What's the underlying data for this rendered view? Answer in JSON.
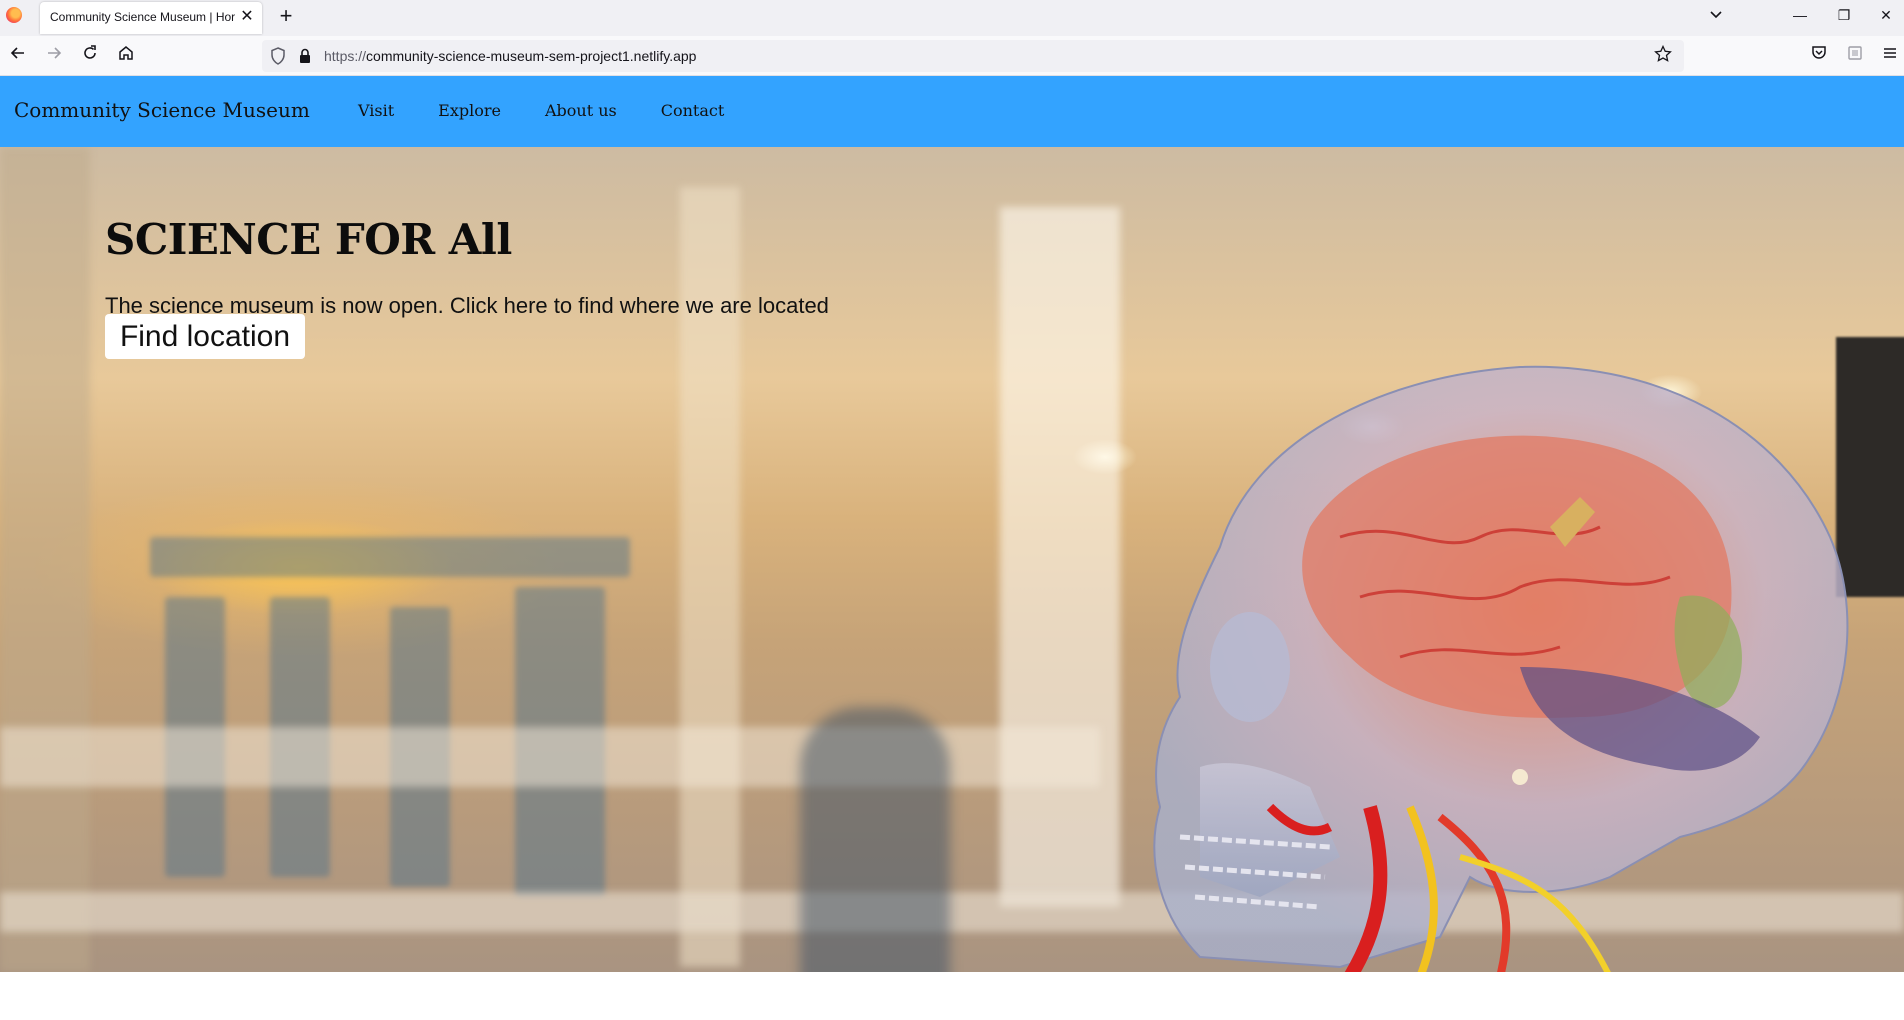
{
  "browser": {
    "tab_title": "Community Science Museum | Hor",
    "tab_close": "✕",
    "new_tab": "+",
    "list_tabs": "⌄",
    "window_controls": {
      "minimize": "—",
      "restore": "❐",
      "close": "✕"
    },
    "url_protocol": "https://",
    "url_host": "community-science-museum-sem-project1.netlify.app",
    "nav_icons": [
      "back-icon",
      "forward-icon",
      "reload-icon",
      "home-icon"
    ],
    "right_icons": [
      "pocket-icon",
      "extensions-icon",
      "menu-icon"
    ]
  },
  "site": {
    "brand": "Community Science Museum",
    "menu": [
      {
        "label": "Visit"
      },
      {
        "label": "Explore"
      },
      {
        "label": "About us"
      },
      {
        "label": "Contact"
      }
    ],
    "header_color": "#33a3ff"
  },
  "hero": {
    "title": "SCIENCE FOR All",
    "text": "The science museum is now open. Click here to find where we are located",
    "button_label": "Find location",
    "image_subject": "transparent-skull-model-image"
  }
}
